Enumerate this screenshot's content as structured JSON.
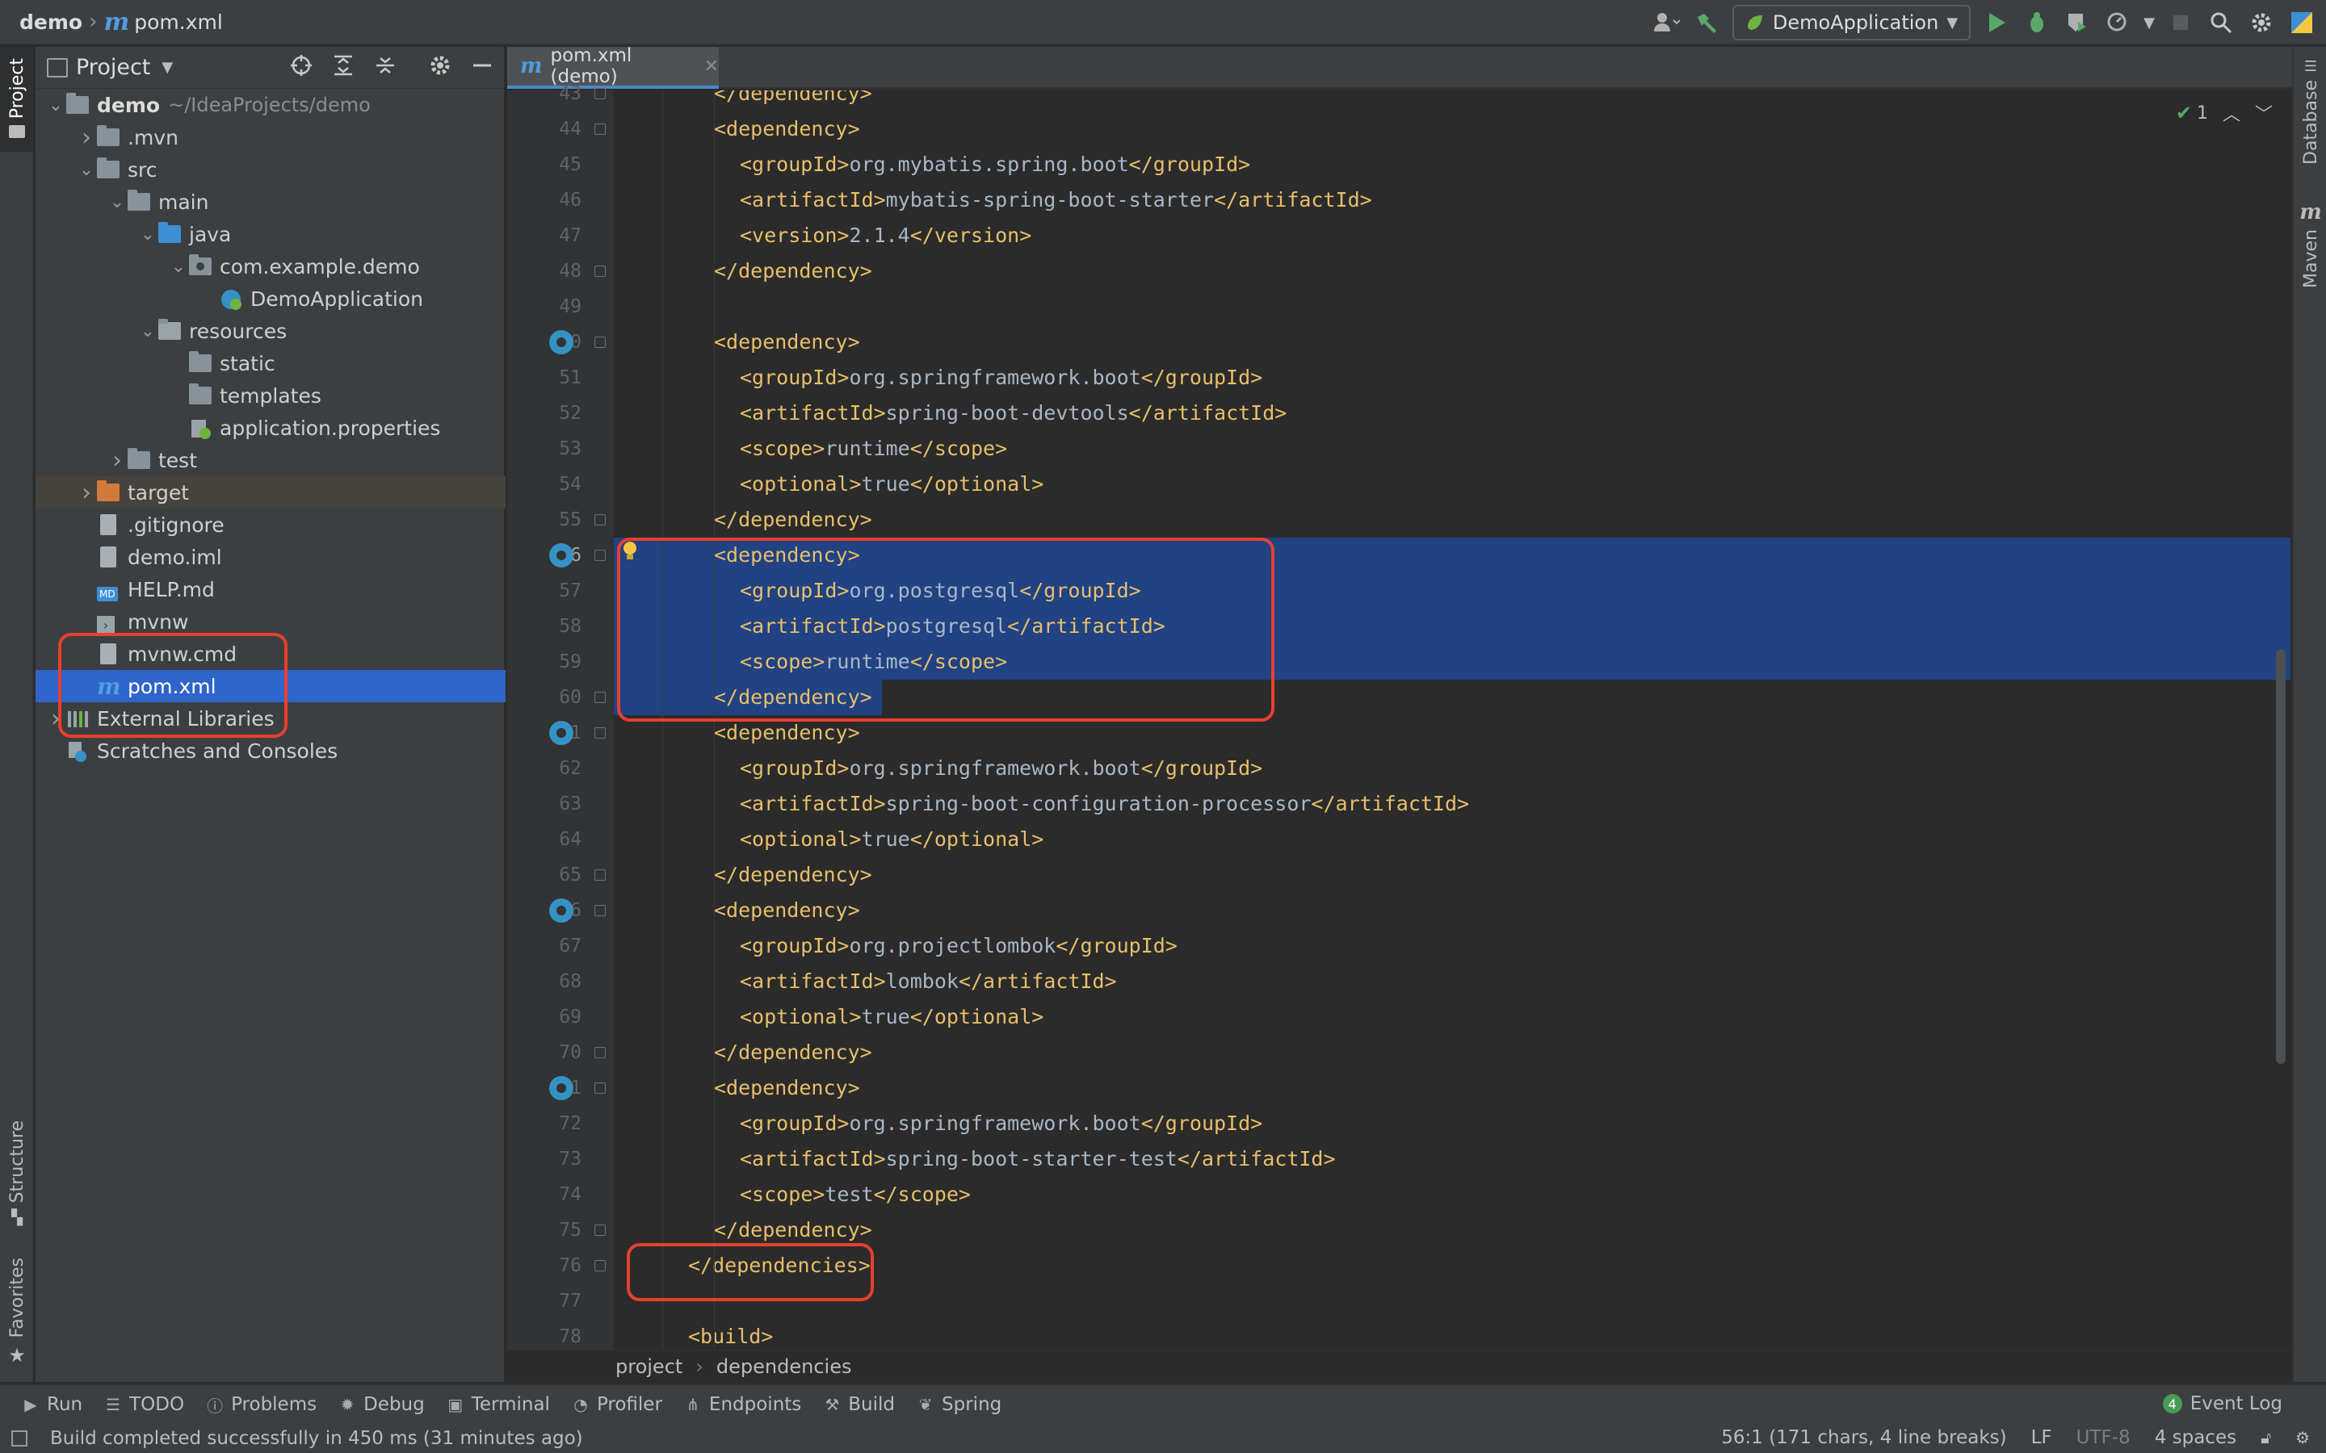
{
  "navbar": {
    "project": "demo",
    "file": "pom.xml",
    "run_config": "DemoApplication"
  },
  "left_tabs": {
    "project": "Project",
    "structure": "Structure",
    "favorites": "Favorites"
  },
  "right_tabs": {
    "database": "Database",
    "maven": "Maven"
  },
  "project_panel": {
    "title": "Project",
    "tree": [
      {
        "label": "demo",
        "extra": "~/IdeaProjects/demo",
        "depth": 0,
        "chev": "down",
        "icon": "folder",
        "bold": true
      },
      {
        "label": ".mvn",
        "depth": 1,
        "chev": "right",
        "icon": "folder"
      },
      {
        "label": "src",
        "depth": 1,
        "chev": "down",
        "icon": "folder"
      },
      {
        "label": "main",
        "depth": 2,
        "chev": "down",
        "icon": "folder"
      },
      {
        "label": "java",
        "depth": 3,
        "chev": "down",
        "icon": "folder-blue"
      },
      {
        "label": "com.example.demo",
        "depth": 4,
        "chev": "down",
        "icon": "package"
      },
      {
        "label": "DemoApplication",
        "depth": 5,
        "chev": "",
        "icon": "spring-class"
      },
      {
        "label": "resources",
        "depth": 3,
        "chev": "down",
        "icon": "folder-res"
      },
      {
        "label": "static",
        "depth": 4,
        "chev": "",
        "icon": "folder"
      },
      {
        "label": "templates",
        "depth": 4,
        "chev": "",
        "icon": "folder"
      },
      {
        "label": "application.properties",
        "depth": 4,
        "chev": "",
        "icon": "spring-props"
      },
      {
        "label": "test",
        "depth": 2,
        "chev": "right",
        "icon": "folder"
      },
      {
        "label": "target",
        "depth": 1,
        "chev": "right",
        "icon": "folder-orange",
        "excluded": true
      },
      {
        "label": ".gitignore",
        "depth": 1,
        "chev": "",
        "icon": "file"
      },
      {
        "label": "demo.iml",
        "depth": 1,
        "chev": "",
        "icon": "file"
      },
      {
        "label": "HELP.md",
        "depth": 1,
        "chev": "",
        "icon": "md"
      },
      {
        "label": "mvnw",
        "depth": 1,
        "chev": "",
        "icon": "shell"
      },
      {
        "label": "mvnw.cmd",
        "depth": 1,
        "chev": "",
        "icon": "file"
      },
      {
        "label": "pom.xml",
        "depth": 1,
        "chev": "",
        "icon": "maven",
        "selected": true
      },
      {
        "label": "External Libraries",
        "depth": 0,
        "chev": "right",
        "icon": "libs"
      },
      {
        "label": "Scratches and Consoles",
        "depth": 0,
        "chev": "",
        "icon": "scratch"
      }
    ]
  },
  "editor": {
    "tab_label": "pom.xml (demo)",
    "inspection_count": "1",
    "lines": [
      {
        "n": "43",
        "indent": 2,
        "tokens": [
          [
            "tag",
            "</dependency>"
          ]
        ]
      },
      {
        "n": "44",
        "indent": 2,
        "tokens": [
          [
            "tag",
            "<dependency>"
          ]
        ]
      },
      {
        "n": "45",
        "indent": 3,
        "tokens": [
          [
            "tag",
            "<groupId>"
          ],
          [
            "txt",
            "org.mybatis.spring.boot"
          ],
          [
            "tag",
            "</groupId>"
          ]
        ]
      },
      {
        "n": "46",
        "indent": 3,
        "tokens": [
          [
            "tag",
            "<artifactId>"
          ],
          [
            "txt",
            "mybatis-spring-boot-starter"
          ],
          [
            "tag",
            "</artifactId>"
          ]
        ]
      },
      {
        "n": "47",
        "indent": 3,
        "tokens": [
          [
            "tag",
            "<version>"
          ],
          [
            "txt",
            "2.1.4"
          ],
          [
            "tag",
            "</version>"
          ]
        ]
      },
      {
        "n": "48",
        "indent": 2,
        "tokens": [
          [
            "tag",
            "</dependency>"
          ]
        ]
      },
      {
        "n": "49",
        "indent": 0,
        "tokens": []
      },
      {
        "n": "50",
        "indent": 2,
        "tokens": [
          [
            "tag",
            "<dependency>"
          ]
        ]
      },
      {
        "n": "51",
        "indent": 3,
        "tokens": [
          [
            "tag",
            "<groupId>"
          ],
          [
            "txt",
            "org.springframework.boot"
          ],
          [
            "tag",
            "</groupId>"
          ]
        ]
      },
      {
        "n": "52",
        "indent": 3,
        "tokens": [
          [
            "tag",
            "<artifactId>"
          ],
          [
            "txt",
            "spring-boot-devtools"
          ],
          [
            "tag",
            "</artifactId>"
          ]
        ]
      },
      {
        "n": "53",
        "indent": 3,
        "tokens": [
          [
            "tag",
            "<scope>"
          ],
          [
            "txt",
            "runtime"
          ],
          [
            "tag",
            "</scope>"
          ]
        ]
      },
      {
        "n": "54",
        "indent": 3,
        "tokens": [
          [
            "tag",
            "<optional>"
          ],
          [
            "txt",
            "true"
          ],
          [
            "tag",
            "</optional>"
          ]
        ]
      },
      {
        "n": "55",
        "indent": 2,
        "tokens": [
          [
            "tag",
            "</dependency>"
          ]
        ]
      },
      {
        "n": "56",
        "indent": 2,
        "tokens": [
          [
            "tag",
            "<dependency>"
          ]
        ],
        "hl": true,
        "cur": true
      },
      {
        "n": "57",
        "indent": 3,
        "tokens": [
          [
            "tag",
            "<groupId>"
          ],
          [
            "txt",
            "org.postgresql"
          ],
          [
            "tag",
            "</groupId>"
          ]
        ],
        "hl": true
      },
      {
        "n": "58",
        "indent": 3,
        "tokens": [
          [
            "tag",
            "<artifactId>"
          ],
          [
            "txt",
            "postgresql"
          ],
          [
            "tag",
            "</artifactId>"
          ]
        ],
        "hl": true
      },
      {
        "n": "59",
        "indent": 3,
        "tokens": [
          [
            "tag",
            "<scope>"
          ],
          [
            "txt",
            "runtime"
          ],
          [
            "tag",
            "</scope>"
          ]
        ],
        "hl": true
      },
      {
        "n": "60",
        "indent": 2,
        "tokens": [
          [
            "tag",
            "</dependency>"
          ]
        ],
        "hlpart": true
      },
      {
        "n": "61",
        "indent": 2,
        "tokens": [
          [
            "tag",
            "<dependency>"
          ]
        ]
      },
      {
        "n": "62",
        "indent": 3,
        "tokens": [
          [
            "tag",
            "<groupId>"
          ],
          [
            "txt",
            "org.springframework.boot"
          ],
          [
            "tag",
            "</groupId>"
          ]
        ]
      },
      {
        "n": "63",
        "indent": 3,
        "tokens": [
          [
            "tag",
            "<artifactId>"
          ],
          [
            "txt",
            "spring-boot-configuration-processor"
          ],
          [
            "tag",
            "</artifactId>"
          ]
        ]
      },
      {
        "n": "64",
        "indent": 3,
        "tokens": [
          [
            "tag",
            "<optional>"
          ],
          [
            "txt",
            "true"
          ],
          [
            "tag",
            "</optional>"
          ]
        ]
      },
      {
        "n": "65",
        "indent": 2,
        "tokens": [
          [
            "tag",
            "</dependency>"
          ]
        ]
      },
      {
        "n": "66",
        "indent": 2,
        "tokens": [
          [
            "tag",
            "<dependency>"
          ]
        ]
      },
      {
        "n": "67",
        "indent": 3,
        "tokens": [
          [
            "tag",
            "<groupId>"
          ],
          [
            "txt",
            "org.projectlombok"
          ],
          [
            "tag",
            "</groupId>"
          ]
        ]
      },
      {
        "n": "68",
        "indent": 3,
        "tokens": [
          [
            "tag",
            "<artifactId>"
          ],
          [
            "txt",
            "lombok"
          ],
          [
            "tag",
            "</artifactId>"
          ]
        ]
      },
      {
        "n": "69",
        "indent": 3,
        "tokens": [
          [
            "tag",
            "<optional>"
          ],
          [
            "txt",
            "true"
          ],
          [
            "tag",
            "</optional>"
          ]
        ]
      },
      {
        "n": "70",
        "indent": 2,
        "tokens": [
          [
            "tag",
            "</dependency>"
          ]
        ]
      },
      {
        "n": "71",
        "indent": 2,
        "tokens": [
          [
            "tag",
            "<dependency>"
          ]
        ]
      },
      {
        "n": "72",
        "indent": 3,
        "tokens": [
          [
            "tag",
            "<groupId>"
          ],
          [
            "txt",
            "org.springframework.boot"
          ],
          [
            "tag",
            "</groupId>"
          ]
        ]
      },
      {
        "n": "73",
        "indent": 3,
        "tokens": [
          [
            "tag",
            "<artifactId>"
          ],
          [
            "txt",
            "spring-boot-starter-test"
          ],
          [
            "tag",
            "</artifactId>"
          ]
        ]
      },
      {
        "n": "74",
        "indent": 3,
        "tokens": [
          [
            "tag",
            "<scope>"
          ],
          [
            "txt",
            "test"
          ],
          [
            "tag",
            "</scope>"
          ]
        ]
      },
      {
        "n": "75",
        "indent": 2,
        "tokens": [
          [
            "tag",
            "</dependency>"
          ]
        ]
      },
      {
        "n": "76",
        "indent": 1,
        "tokens": [
          [
            "tag",
            "</dependencies>"
          ]
        ]
      },
      {
        "n": "77",
        "indent": 0,
        "tokens": []
      },
      {
        "n": "78",
        "indent": 1,
        "tokens": [
          [
            "tag",
            "<build>"
          ]
        ]
      }
    ],
    "breadcrumb": [
      "project",
      "dependencies"
    ]
  },
  "toolwindows": [
    "Run",
    "TODO",
    "Problems",
    "Debug",
    "Terminal",
    "Profiler",
    "Endpoints",
    "Build",
    "Spring"
  ],
  "event_log": {
    "label": "Event Log",
    "count": "4"
  },
  "status": {
    "message": "Build completed successfully in 450 ms (31 minutes ago)",
    "position": "56:1 (171 chars, 4 line breaks)",
    "line_sep": "LF",
    "encoding": "UTF-8",
    "indent": "4 spaces"
  },
  "colors": {
    "accent": "#2f65ca",
    "tag": "#e8bf6a",
    "text": "#a9b7c6",
    "selection": "#214283",
    "annotation": "#e8402e"
  }
}
